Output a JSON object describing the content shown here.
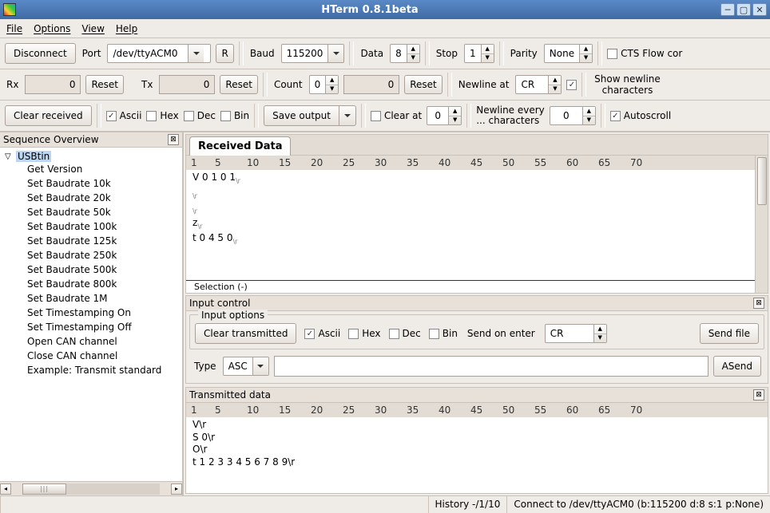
{
  "window": {
    "title": "HTerm 0.8.1beta"
  },
  "menu": {
    "file": "File",
    "options": "Options",
    "view": "View",
    "help": "Help"
  },
  "tb1": {
    "disconnect": "Disconnect",
    "port_lbl": "Port",
    "port_val": "/dev/ttyACM0",
    "r_btn": "R",
    "baud_lbl": "Baud",
    "baud_val": "115200",
    "data_lbl": "Data",
    "data_val": "8",
    "stop_lbl": "Stop",
    "stop_val": "1",
    "parity_lbl": "Parity",
    "parity_val": "None",
    "cts_lbl": "CTS Flow cor"
  },
  "tb2": {
    "rx_lbl": "Rx",
    "rx_val": "0",
    "reset1": "Reset",
    "tx_lbl": "Tx",
    "tx_val": "0",
    "reset2": "Reset",
    "count_lbl": "Count",
    "count_val": "0",
    "count_disp": "0",
    "reset3": "Reset",
    "nl_lbl": "Newline at",
    "nl_val": "CR",
    "shownl_lbl": "Show newline characters"
  },
  "tb3": {
    "clear_rx": "Clear received",
    "ascii": "Ascii",
    "hex": "Hex",
    "dec": "Dec",
    "bin": "Bin",
    "save": "Save output",
    "clear_at": "Clear at",
    "clear_at_val": "0",
    "nl_every_lbl1": "Newline every",
    "nl_every_lbl2": "... characters",
    "nl_every_val": "0",
    "autoscroll": "Autoscroll"
  },
  "sidebar": {
    "title": "Sequence Overview",
    "root": "USBtin",
    "items": [
      "Get Version",
      "Set Baudrate 10k",
      "Set Baudrate 20k",
      "Set Baudrate 50k",
      "Set Baudrate 100k",
      "Set Baudrate 125k",
      "Set Baudrate 250k",
      "Set Baudrate 500k",
      "Set Baudrate 800k",
      "Set Baudrate 1M",
      "Set Timestamping On",
      "Set Timestamping Off",
      "Open CAN channel",
      "Close CAN channel",
      "Example: Transmit standard"
    ]
  },
  "rx": {
    "tab": "Received Data",
    "ruler": [
      "1",
      "5",
      "10",
      "15",
      "20",
      "25",
      "30",
      "35",
      "40",
      "45",
      "50",
      "55",
      "60",
      "65",
      "70"
    ],
    "lines": [
      {
        "t": "V0101",
        "nl": "\\r"
      },
      {
        "t": "",
        "nl": "\\r"
      },
      {
        "t": "",
        "nl": "\\r"
      },
      {
        "t": "z",
        "nl": "\\r"
      },
      {
        "t": "t0450",
        "nl": "\\r"
      }
    ],
    "selection": "Selection (-)"
  },
  "input": {
    "title": "Input control",
    "options_title": "Input options",
    "clear_tx": "Clear transmitted",
    "ascii": "Ascii",
    "hex": "Hex",
    "dec": "Dec",
    "bin": "Bin",
    "send_on_enter": "Send on enter",
    "soe_val": "CR",
    "send_file": "Send file",
    "type_lbl": "Type",
    "type_val": "ASC",
    "asend": "ASend"
  },
  "tx": {
    "title": "Transmitted data",
    "ruler": [
      "1",
      "5",
      "10",
      "15",
      "20",
      "25",
      "30",
      "35",
      "40",
      "45",
      "50",
      "55",
      "60",
      "65",
      "70"
    ],
    "lines": [
      {
        "t": "V",
        "nl": "\\r"
      },
      {
        "t": "S0",
        "nl": "\\r"
      },
      {
        "t": "O",
        "nl": "\\r"
      },
      {
        "t": "t1233456789",
        "nl": "\\r"
      }
    ]
  },
  "status": {
    "history": "History -/1/10",
    "conn": "Connect to /dev/ttyACM0 (b:115200 d:8 s:1 p:None)"
  }
}
